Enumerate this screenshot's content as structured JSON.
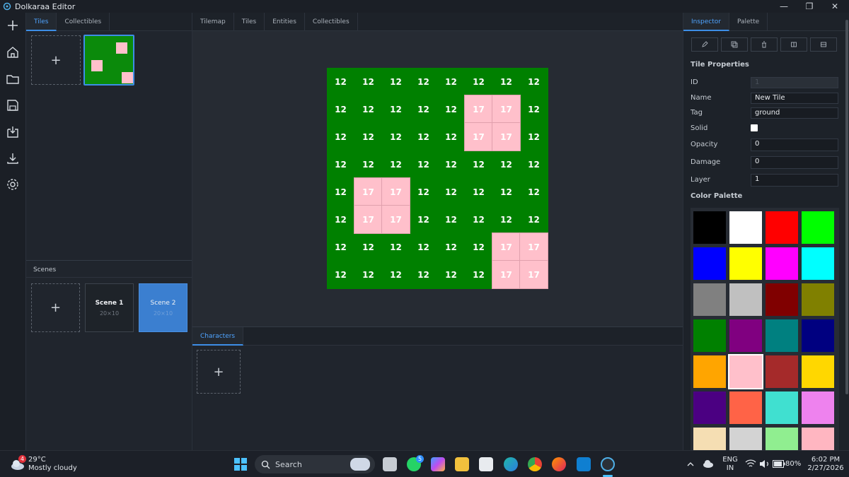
{
  "window": {
    "title": "Dolkaraa Editor"
  },
  "left_tabs": [
    "Tiles",
    "Collectibles"
  ],
  "scenes": {
    "label": "Scenes",
    "items": [
      {
        "name": "Scene 1",
        "size": "20×10"
      },
      {
        "name": "Scene 2",
        "size": "20×10"
      }
    ]
  },
  "center_tabs": [
    "Tilemap",
    "Tiles",
    "Entities",
    "Collectibles"
  ],
  "tilemap": [
    [
      "12",
      "12",
      "12",
      "12",
      "12",
      "12",
      "12",
      "12"
    ],
    [
      "12",
      "12",
      "12",
      "12",
      "12",
      "17",
      "17",
      "12"
    ],
    [
      "12",
      "12",
      "12",
      "12",
      "12",
      "17",
      "17",
      "12"
    ],
    [
      "12",
      "12",
      "12",
      "12",
      "12",
      "12",
      "12",
      "12"
    ],
    [
      "12",
      "17",
      "17",
      "12",
      "12",
      "12",
      "12",
      "12"
    ],
    [
      "12",
      "17",
      "17",
      "12",
      "12",
      "12",
      "12",
      "12"
    ],
    [
      "12",
      "12",
      "12",
      "12",
      "12",
      "12",
      "17",
      "17"
    ],
    [
      "12",
      "12",
      "12",
      "12",
      "12",
      "12",
      "17",
      "17"
    ]
  ],
  "characters_tab": "Characters",
  "right_tabs": [
    "Inspector",
    "Palette"
  ],
  "inspector": {
    "section": "Tile Properties",
    "fields": [
      {
        "label": "ID",
        "value": "1"
      },
      {
        "label": "Name",
        "value": "New Tile"
      },
      {
        "label": "Tag",
        "value": "ground"
      },
      {
        "label": "Solid",
        "value": ""
      },
      {
        "label": "Opacity",
        "value": "0"
      },
      {
        "label": "Damage",
        "value": "0"
      },
      {
        "label": "Layer",
        "value": "1"
      }
    ],
    "palette_label": "Color Palette",
    "colors": [
      "#000000",
      "#ffffff",
      "#ff0000",
      "#00ff00",
      "#0000ff",
      "#ffff00",
      "#ff00ff",
      "#00ffff",
      "#808080",
      "#c0c0c0",
      "#800000",
      "#808000",
      "#008000",
      "#800080",
      "#008080",
      "#000080",
      "#ffa500",
      "#ffc0cb",
      "#a52a2a",
      "#ffd700",
      "#4b0082",
      "#ff6347",
      "#40e0d0",
      "#ee82ee",
      "#f5deb3",
      "#d3d3d3",
      "#90ee90",
      "#ffb6c1"
    ]
  },
  "taskbar": {
    "weather_temp": "29°C",
    "weather_desc": "Mostly cloudy",
    "weather_badge": "4",
    "search": "Search",
    "whatsapp_badge": "5",
    "lang1": "ENG",
    "lang2": "IN",
    "battery": "80%",
    "time": "6:02 PM",
    "date": "2/27/2026"
  }
}
